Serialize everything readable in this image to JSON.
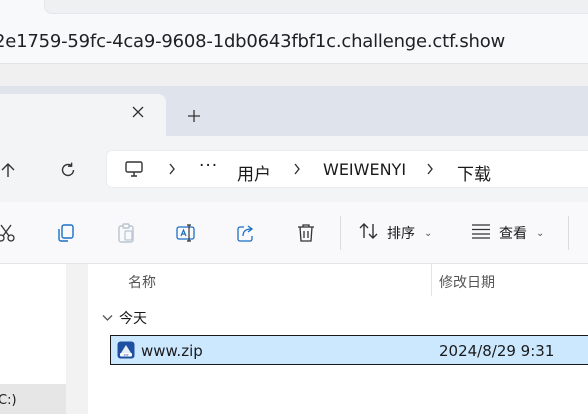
{
  "browser": {
    "url": "2e1759-59fc-4ca9-9608-1db0643fbf1c.challenge.ctf.show"
  },
  "explorer": {
    "tab": {
      "close_icon": "close-icon"
    },
    "new_tab_icon": "plus-icon",
    "nav": {
      "up_icon": "arrow-up-icon",
      "refresh_icon": "refresh-icon"
    },
    "breadcrumb": {
      "computer_icon": "monitor-icon",
      "ellipsis": "···",
      "items": [
        "用户",
        "WEIWENYI",
        "下载"
      ]
    },
    "toolbar": {
      "icons": [
        "cut-icon",
        "copy-icon",
        "paste-icon",
        "rename-icon",
        "share-icon",
        "delete-icon"
      ],
      "sort_label": "排序",
      "view_label": "查看"
    },
    "columns": {
      "name": "名称",
      "modified": "修改日期"
    },
    "group_label": "今天",
    "files": [
      {
        "name": "www.zip",
        "modified": "2024/8/29 9:31",
        "icon": "zip-archive-icon",
        "selected": true
      }
    ],
    "sidebar": {
      "drive_label": "C:)"
    }
  }
}
